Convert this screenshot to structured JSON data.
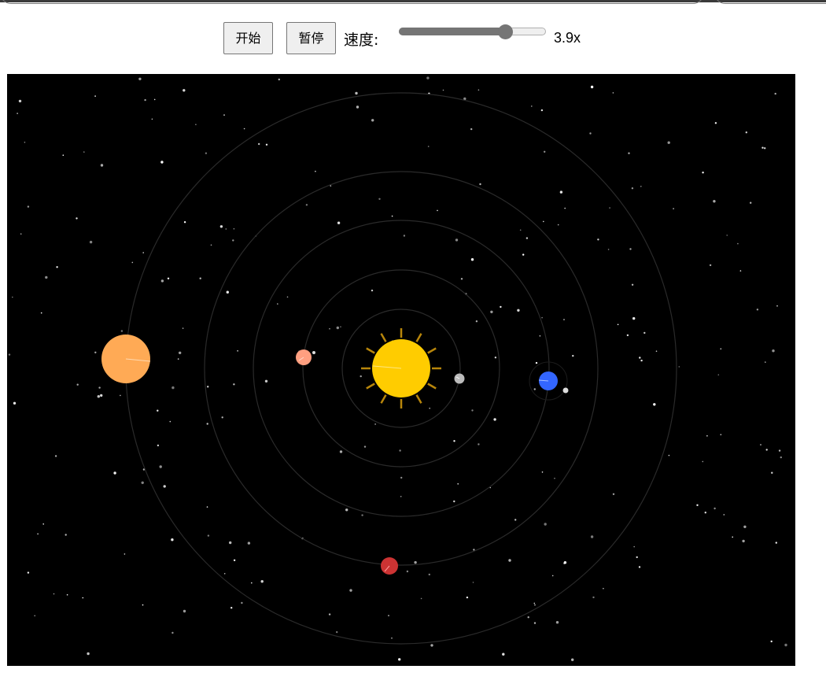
{
  "controls": {
    "start_label": "开始",
    "pause_label": "暂停",
    "speed_label": "速度:",
    "speed_value_text": "3.9x",
    "speed_slider_fraction": 0.72
  },
  "scene": {
    "background_color": "#000000",
    "orbit_color": "#2a2a2a",
    "sun_color": "#ffcc00",
    "planet_colors": {
      "inner_gray": "#bbbbbb",
      "salmon": "#ff9f80",
      "blue": "#3366ff",
      "red": "#cc3333",
      "orange": "#ffaa55"
    }
  }
}
